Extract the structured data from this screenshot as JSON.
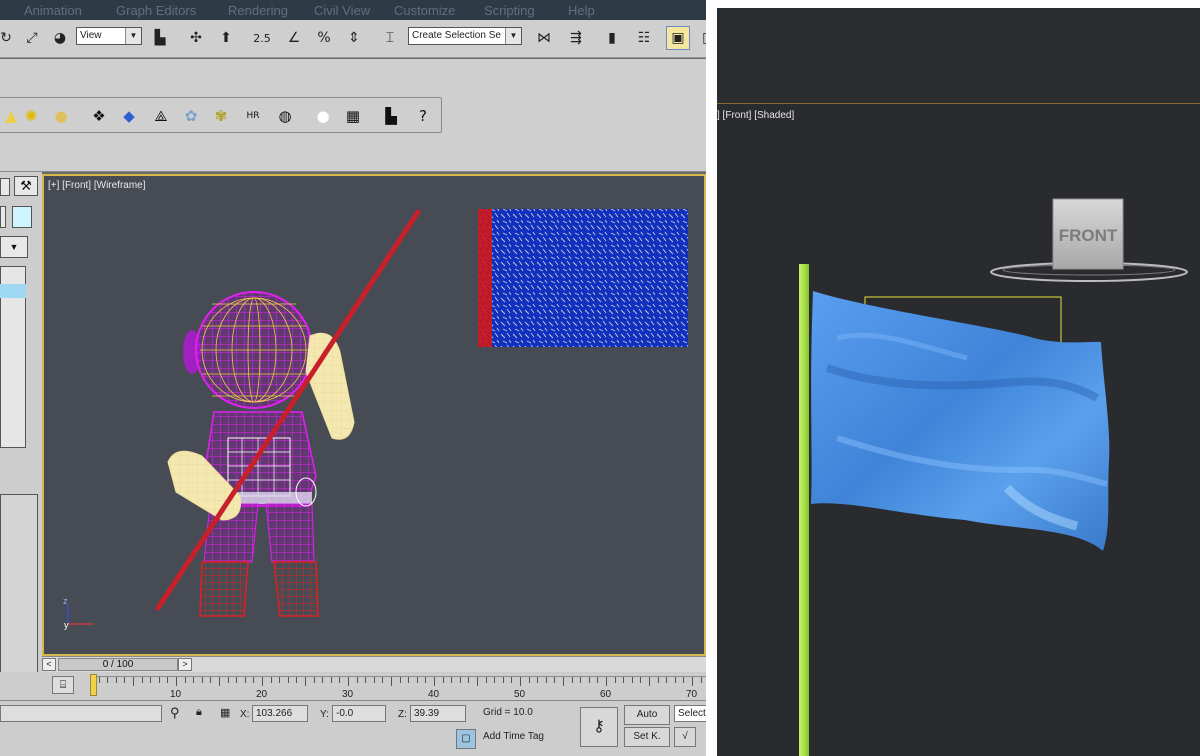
{
  "menu": {
    "items": [
      "Animation",
      "Graph Editors",
      "Rendering",
      "Civil View",
      "Customize",
      "Scripting",
      "Help"
    ]
  },
  "toolbar": {
    "reference_coord": "View",
    "selection_set_placeholder": "Create Selection Se",
    "snap_angle_label": "2.5"
  },
  "viewport": {
    "label": "[+] [Front] [Wireframe]",
    "axis_y": "y",
    "axis_z": "z"
  },
  "timeslider": {
    "position": "0 / 100",
    "prev": "<",
    "next": ">"
  },
  "trackbar": {
    "ticks": [
      "10",
      "20",
      "30",
      "40",
      "50",
      "60",
      "70"
    ]
  },
  "status": {
    "x_label": "X:",
    "x_value": "103.266",
    "y_label": "Y:",
    "y_value": "-0.0",
    "z_label": "Z:",
    "z_value": "39.39",
    "grid": "Grid = 10.0",
    "add_time_tag": "Add Time Tag",
    "auto": "Auto",
    "set_key": "Set K.",
    "selected": "Selecte"
  },
  "right_viewport": {
    "label": "] [Front] [Shaded]",
    "viewcube_face": "FRONT"
  },
  "colors": {
    "viewport_bg": "#474c54",
    "viewport_border": "#d8b84a",
    "flag_blue": "#4a8ee0",
    "pole_green": "#a8e04a",
    "rod_red": "#c8202a"
  }
}
